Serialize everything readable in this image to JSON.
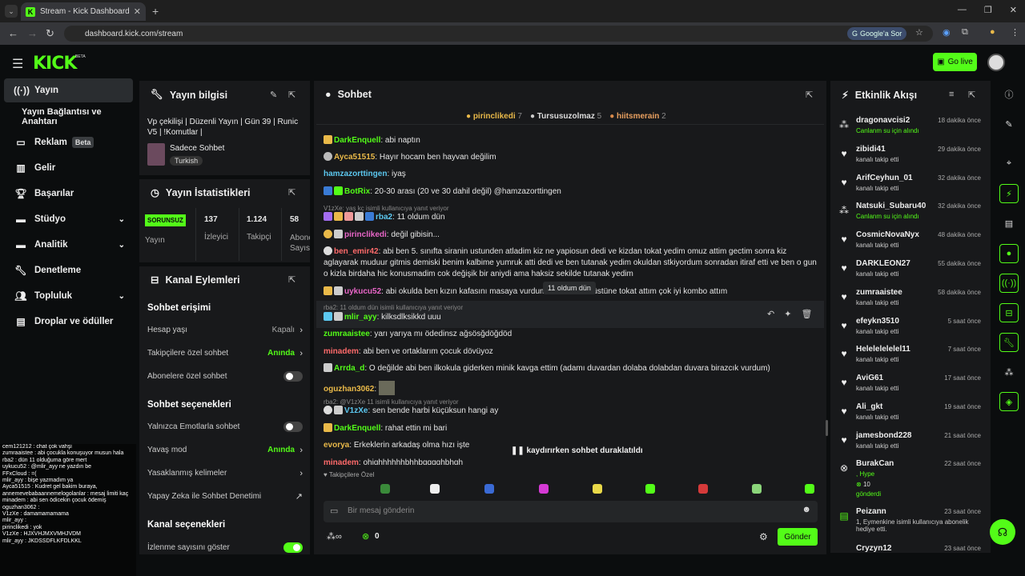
{
  "browser": {
    "tab_title": "Stream - Kick Dashboard",
    "url": "dashboard.kick.com/stream",
    "google_btn": "Google'a Sor"
  },
  "header": {
    "logo": "KICK",
    "logo_beta": "BETA",
    "golive": "Go live"
  },
  "sidebar": {
    "items": [
      {
        "label": "Yayın",
        "icon": "broadcast-icon"
      },
      {
        "label": "Yayın Bağlantısı ve Anahtarı"
      },
      {
        "label": "Reklam",
        "badge": "Beta",
        "icon": "ad-icon"
      },
      {
        "label": "Gelir",
        "icon": "chart-icon"
      },
      {
        "label": "Başarılar",
        "icon": "trophy-icon"
      },
      {
        "label": "Stüdyo",
        "icon": "studio-icon"
      },
      {
        "label": "Analitik",
        "icon": "analytics-icon"
      },
      {
        "label": "Denetleme",
        "icon": "wrench-icon"
      },
      {
        "label": "Topluluk",
        "icon": "community-icon"
      },
      {
        "label": "Droplar ve ödüller",
        "icon": "gift-icon"
      }
    ]
  },
  "stream_info": {
    "title": "Yayın bilgisi",
    "stream_title": "Vp çekilişi | Düzenli Yayın | Gün 39 | Runic V5 | !Komutlar |",
    "category": "Sadece Sohbet",
    "tag": "Turkish"
  },
  "stats": {
    "title": "Yayın İstatistikleri",
    "status": "SORUNSUZ",
    "status_label": "Yayın",
    "viewers": "137",
    "viewers_label": "İzleyici",
    "followers": "1.124",
    "followers_label": "Takipçi",
    "subs": "58",
    "subs_label": "Abone Sayısı"
  },
  "actions": {
    "title": "Kanal Eylemleri",
    "chat_access": "Sohbet erişimi",
    "account_age": "Hesap yaşı",
    "account_age_val": "Kapalı",
    "followers_only": "Takipçilere özel sohbet",
    "followers_only_val": "Anında",
    "subs_only": "Abonelere özel sohbet",
    "chat_options": "Sohbet seçenekleri",
    "emote_only": "Yalnızca Emotlarla sohbet",
    "slow_mode": "Yavaş mod",
    "slow_mode_val": "Anında",
    "banned_words": "Yasaklanmış kelimeler",
    "ai_moderation": "Yapay Zeka ile Sohbet Denetimi",
    "channel_options": "Kanal seçenekleri",
    "viewer_count": "İzlenme sayısını göster"
  },
  "chat": {
    "title": "Sohbet",
    "top1": "pirinclikedi",
    "top1_n": "7",
    "top2": "Tursusuzolmaz",
    "top2_n": "5",
    "top3": "hiitsmerain",
    "top3_n": "2",
    "messages": [
      {
        "user": "DarkEnquell",
        "color": "#53fc18",
        "text": "abi naptın"
      },
      {
        "user": "Ayca51515",
        "color": "#e9b949",
        "text": "Hayır hocam ben hayvan değilim"
      },
      {
        "user": "hamzazorttingen",
        "color": "#5cc8f0",
        "text": "iyaş"
      },
      {
        "user": "BotRix",
        "color": "#53fc18",
        "text": "20-30 arası (20 ve 30 dahil değil) @hamzazorttingen"
      },
      {
        "reply": "V1zXe: yaş kç isimli kullanıcıya yanıt veriyor",
        "user": "rba2",
        "color": "#5cc8f0",
        "text": "11 oldum dün"
      },
      {
        "user": "pirinclikedi",
        "color": "#e966c8",
        "text": "değil gibisin..."
      },
      {
        "user": "ben_emir42",
        "color": "#ff6a6a",
        "text": "abi ben 5. sınıfta siranin ustunden atladim kiz ne yapiosun dedi ve kizdan tokat yedim omuz attim gectim sonra kiz aglayarak muduur gitmis demiski benim kalbime yumruk atti dedi ve ben tutanak yedim okuldan stkiyordum sonradan itiraf etti ve ben o gun o kizla birdaha hic konusmadim cok değişik bir aniydi ama haksiz sekilde tutanak yedim"
      },
      {
        "user": "uykucu52",
        "color": "#e966c8",
        "text": "abi okulda ben kızın kafasını masaya vurdum",
        "text2": "üstüne tokat attım çok iyi kombo attım"
      },
      {
        "reply": "rba2: 11 oldum dün isimli kullanıcıya yanıt veriyor",
        "user": "mlir_ayy",
        "color": "#53fc18",
        "text": "kilksdlksikkd uuu"
      },
      {
        "user": "zumraaistee",
        "color": "#53fc18",
        "text": "yarı yarıya mı ödedinsz ağsösğdöğdöd"
      },
      {
        "user": "minadem",
        "color": "#ff6a6a",
        "text": "abi ben ve ortaklarım çocuk dövüyoz"
      },
      {
        "user": "Arrda_d",
        "color": "#53fc18",
        "text": "O değilde abi ben ilkokula giderken minik kavga ettim (adamı duvardan dolaba dolabdan duvara birazcık vurdum)"
      },
      {
        "user": "oguzhan3062",
        "color": "#e9b949",
        "text": ""
      },
      {
        "reply": "rba2: @V1zXe 11 isimli kullanıcıya yanıt veriyor",
        "user": "V1zXe",
        "color": "#5cc8f0",
        "text": "sen bende harbi küçüksun hangi ay"
      },
      {
        "user": "DarkEnquell",
        "color": "#53fc18",
        "text": "rahat ettin mi bari"
      },
      {
        "user": "evorya",
        "color": "#e9b949",
        "text": "Erkeklerin arkadaş olma hızı işte"
      },
      {
        "user": "minadem",
        "color": "#ff6a6a",
        "text": "ohighhhhhhbhhbgggghbhgh"
      }
    ],
    "tooltip": "11 oldum dün",
    "paused": "kaydırırken sohbet duraklatıldı",
    "followers_only": "Takipçilere Özel",
    "placeholder": "Bir mesaj gönderin",
    "send": "Gönder",
    "points": "0"
  },
  "activity": {
    "title": "Etkinlik Akışı",
    "events": [
      {
        "name": "dragonavcisi2",
        "time": "18 dakika önce",
        "sub": "Canlanm su için alındı",
        "green": true,
        "icon": "points-icon"
      },
      {
        "name": "zibidi41",
        "time": "29 dakika önce",
        "sub": "kanalı takip etti",
        "icon": "heart-icon"
      },
      {
        "name": "ArifCeyhun_01",
        "time": "32 dakika önce",
        "sub": "kanalı takip etti",
        "icon": "heart-icon"
      },
      {
        "name": "Natsuki_Subaru40",
        "time": "32 dakika önce",
        "sub": "Canlanm su için alındı",
        "green": true,
        "icon": "points-icon"
      },
      {
        "name": "CosmicNovaNyx",
        "time": "48 dakika önce",
        "sub": "kanalı takip etti",
        "icon": "heart-icon"
      },
      {
        "name": "DARKLEON27",
        "time": "55 dakika önce",
        "sub": "kanalı takip etti",
        "icon": "heart-icon"
      },
      {
        "name": "zumraaistee",
        "time": "58 dakika önce",
        "sub": "kanalı takip etti",
        "icon": "heart-icon"
      },
      {
        "name": "efeykn3510",
        "time": "5 saat önce",
        "sub": "kanalı takip etti",
        "icon": "heart-icon"
      },
      {
        "name": "Helelelelelel11",
        "time": "7 saat önce",
        "sub": "kanalı takip etti",
        "icon": "heart-icon"
      },
      {
        "name": "AviG61",
        "time": "17 saat önce",
        "sub": "kanalı takip etti",
        "icon": "heart-icon"
      },
      {
        "name": "Ali_gkt",
        "time": "19 saat önce",
        "sub": "kanalı takip etti",
        "icon": "heart-icon"
      },
      {
        "name": "jamesbond228",
        "time": "21 saat önce",
        "sub": "kanalı takip etti",
        "icon": "heart-icon"
      }
    ],
    "hype": {
      "name": "BurakCan",
      "time": "22 saat önce",
      "line1": ", Hype",
      "count": "10",
      "line2": "gönderdi"
    },
    "gift": {
      "name": "Peizann",
      "time": "23 saat önce",
      "line": "1, Eymenkine isimli kullanıcıya abonelik hediye etti."
    },
    "last": {
      "name": "Cryzyn12",
      "time": "23 saat önce"
    }
  },
  "overlay": [
    "cem121212 : chat çok vahşi",
    "zumraaistee : abi çocukla konuşuyor musun hala",
    "rba2 : dün 11 olduğuma göre mert",
    "uykucu52 : @mlir_ayy ne yazdın be",
    "FFxCloud : =(",
    "mlir_ayy : bişe yazmadım ya",
    "Ayca51515 : Kudret gel bakim buraya,",
    "annemevebabaannemelogolanlar : mesaj limiti kaç",
    "minadem : abi sen ödicekin çocuk ödemiş",
    "oguzhan3062 :",
    "V1zXe : damamamamama",
    "mlir_ayy :",
    "pirinclikedi : yok",
    "V1zXe : HJXVHJMXVMHJVDM",
    "mlir_ayy : JKDSSDFLKFDLKKL"
  ]
}
